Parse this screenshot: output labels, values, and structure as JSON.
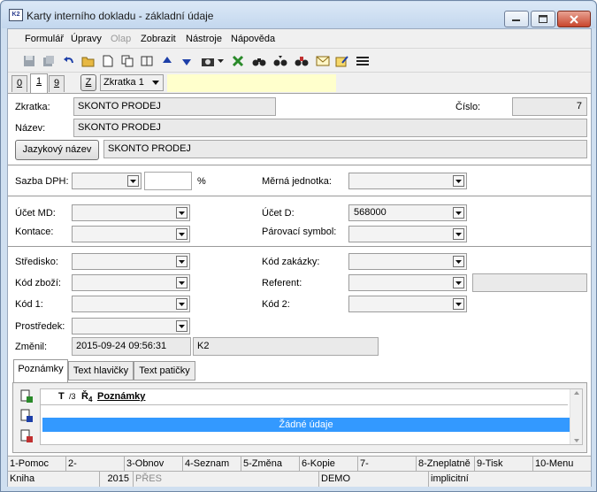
{
  "window": {
    "title": "Karty interního dokladu - základní údaje",
    "icon": "K2-app-icon"
  },
  "menu": [
    "Formulář",
    "Úpravy",
    "Olap",
    "Zobrazit",
    "Nástroje",
    "Nápověda"
  ],
  "tabs": {
    "t0": "0",
    "t1": "1",
    "t9": "9",
    "z": "Z",
    "combo_value": "Zkratka 1"
  },
  "labels": {
    "zkratka": "Zkratka:",
    "cislo": "Číslo:",
    "nazev": "Název:",
    "jazykovy": "Jazykový název",
    "sazba": "Sazba DPH:",
    "percent": "%",
    "merna": "Měrná jednotka:",
    "ucet_md": "Účet MD:",
    "ucet_d": "Účet D:",
    "kontace": "Kontace:",
    "parovaci": "Párovací symbol:",
    "stredisko": "Středisko:",
    "kod_zakazky": "Kód zakázky:",
    "kod_zbozi": "Kód zboží:",
    "referent": "Referent:",
    "kod1": "Kód 1:",
    "kod2": "Kód 2:",
    "prostredek": "Prostředek:",
    "zmenil": "Změnil:"
  },
  "values": {
    "zkratka": "SKONTO PRODEJ",
    "cislo": "7",
    "nazev": "SKONTO PRODEJ",
    "jazykovy": "SKONTO PRODEJ",
    "ucet_d": "568000",
    "zmenil_date": "2015-09-24 09:56:31",
    "zmenil_user": "K2"
  },
  "notes": {
    "tabs": [
      "Poznámky",
      "Text hlavičky",
      "Text patičky"
    ],
    "header": {
      "t": "T",
      "sub": "/3",
      "r": "Ř",
      "r_sub": "4",
      "title": "Poznámky"
    },
    "empty": "Žádné údaje"
  },
  "fkeys": [
    "1-Pomoc",
    "2-",
    "3-Obnov",
    "4-Seznam",
    "5-Změna",
    "6-Kopie",
    "7-",
    "8-Zneplatně",
    "9-Tisk",
    "10-Menu"
  ],
  "status": [
    "Kniha",
    "2015",
    "PŘES",
    "DEMO",
    "implicitní"
  ],
  "colors": {
    "selection": "#3399ff",
    "highlight_field": "#ffffcc"
  }
}
